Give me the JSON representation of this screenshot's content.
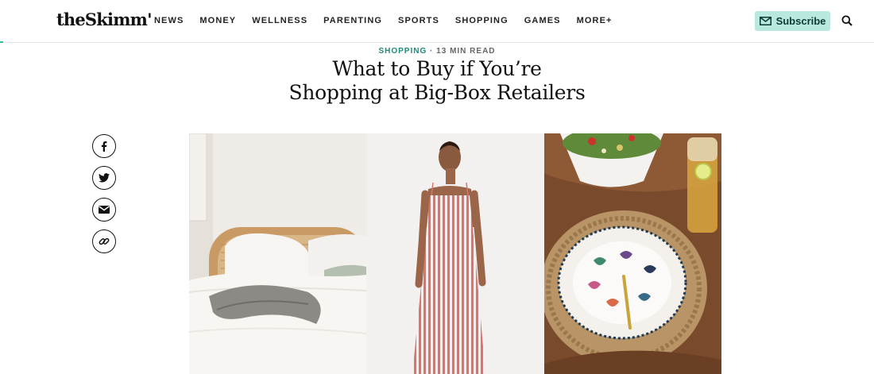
{
  "header": {
    "logo": "theSkimm'",
    "nav": [
      "NEWS",
      "MONEY",
      "WELLNESS",
      "PARENTING",
      "SPORTS",
      "SHOPPING",
      "GAMES",
      "MORE+"
    ],
    "subscribe_label": "Subscribe"
  },
  "article": {
    "category": "SHOPPING",
    "separator": "·",
    "read_time": "13 MIN READ",
    "title_line1": "What to Buy if You’re",
    "title_line2": "Shopping at Big-Box Retailers"
  },
  "share": {
    "icons": [
      "facebook-icon",
      "twitter-icon",
      "email-icon",
      "link-icon"
    ]
  },
  "colors": {
    "accent": "#2bbfa6",
    "subscribe_bg": "#b8e8de",
    "category": "#1f8a78"
  }
}
